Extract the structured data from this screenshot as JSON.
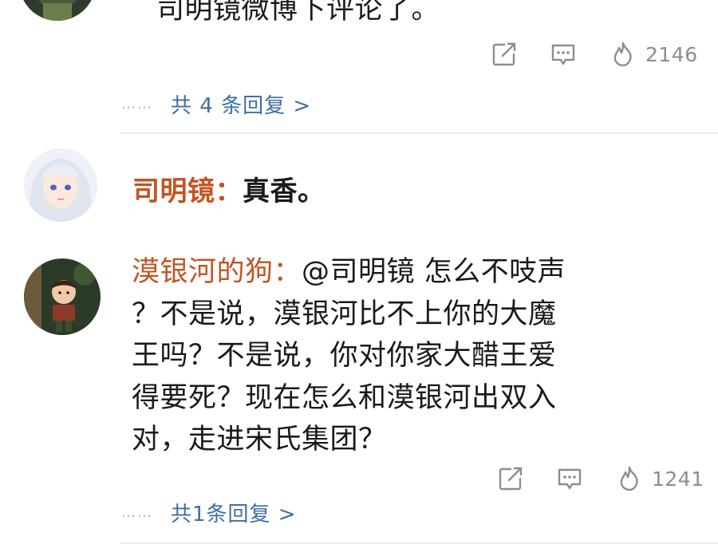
{
  "comments": [
    {
      "text": "司明镜微博下评论了。",
      "actions": {
        "share_icon": "share-icon",
        "comment_icon": "comment-icon",
        "like_icon": "fire-icon",
        "like_count": "2146"
      },
      "replies": {
        "dots": "……",
        "label": "共 4 条回复 >"
      }
    },
    {
      "author": "司明镜：",
      "text": "真香。"
    },
    {
      "author": "漠银河的狗：",
      "lines": [
        "@司明镜 怎么不吱声",
        "？不是说，漠银河比不上你的大魔",
        "王吗？不是说，你对你家大醋王爱",
        "得要死？现在怎么和漠银河出双入",
        "对，走进宋氏集团？"
      ],
      "actions": {
        "share_icon": "share-icon",
        "comment_icon": "comment-icon",
        "like_icon": "fire-icon",
        "like_count": "1241"
      },
      "replies": {
        "dots": "……",
        "label": "共1条回复 >"
      }
    }
  ],
  "colors": {
    "author": "#c25422",
    "link": "#3f6fa3",
    "muted": "#8d8d8d",
    "divider": "#ececec"
  }
}
